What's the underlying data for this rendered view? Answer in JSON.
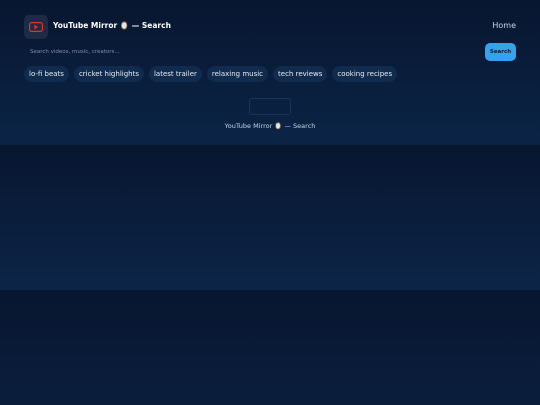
{
  "app": {
    "title": "YouTube Mirror 🪞 — Search",
    "logo_icon": "play-icon",
    "accent": "#33a3ee"
  },
  "nav": {
    "home_label": "Home"
  },
  "search": {
    "placeholder": "Search videos, music, creators...",
    "value": "",
    "button_label": "Search"
  },
  "suggestions": [
    "lo-fi beats",
    "cricket highlights",
    "latest trailer",
    "relaxing music",
    "tech reviews",
    "cooking recipes"
  ],
  "footer": {
    "caption": "YouTube Mirror 🪞 — Search"
  }
}
